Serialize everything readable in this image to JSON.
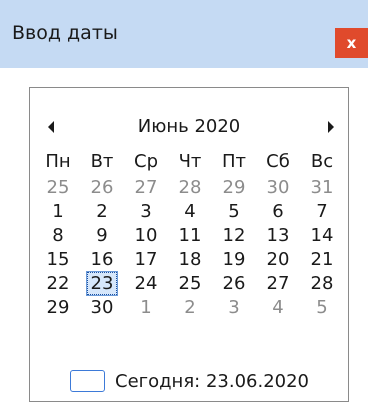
{
  "window": {
    "title": "Ввод даты",
    "close_label": "x"
  },
  "calendar": {
    "month_label": "Июнь 2020",
    "weekdays": [
      "Пн",
      "Вт",
      "Ср",
      "Чт",
      "Пт",
      "Сб",
      "Вс"
    ],
    "weeks": [
      [
        {
          "d": "25",
          "other": true
        },
        {
          "d": "26",
          "other": true
        },
        {
          "d": "27",
          "other": true
        },
        {
          "d": "28",
          "other": true
        },
        {
          "d": "29",
          "other": true
        },
        {
          "d": "30",
          "other": true
        },
        {
          "d": "31",
          "other": true
        }
      ],
      [
        {
          "d": "1"
        },
        {
          "d": "2"
        },
        {
          "d": "3"
        },
        {
          "d": "4"
        },
        {
          "d": "5"
        },
        {
          "d": "6"
        },
        {
          "d": "7"
        }
      ],
      [
        {
          "d": "8"
        },
        {
          "d": "9"
        },
        {
          "d": "10"
        },
        {
          "d": "11"
        },
        {
          "d": "12"
        },
        {
          "d": "13"
        },
        {
          "d": "14"
        }
      ],
      [
        {
          "d": "15"
        },
        {
          "d": "16"
        },
        {
          "d": "17"
        },
        {
          "d": "18"
        },
        {
          "d": "19"
        },
        {
          "d": "20"
        },
        {
          "d": "21"
        }
      ],
      [
        {
          "d": "22"
        },
        {
          "d": "23",
          "selected": true
        },
        {
          "d": "24"
        },
        {
          "d": "25"
        },
        {
          "d": "26"
        },
        {
          "d": "27"
        },
        {
          "d": "28"
        }
      ],
      [
        {
          "d": "29"
        },
        {
          "d": "30"
        },
        {
          "d": "1",
          "other": true
        },
        {
          "d": "2",
          "other": true
        },
        {
          "d": "3",
          "other": true
        },
        {
          "d": "4",
          "other": true
        },
        {
          "d": "5",
          "other": true
        }
      ]
    ],
    "today_text": "Сегодня: 23.06.2020"
  },
  "icons": {
    "prev": "triangle-left-icon",
    "next": "triangle-right-icon"
  },
  "colors": {
    "titlebar": "#c5daf3",
    "close": "#e04a2c",
    "selected_bg": "#d6e7fb",
    "today_box": "#3d7ad8"
  }
}
